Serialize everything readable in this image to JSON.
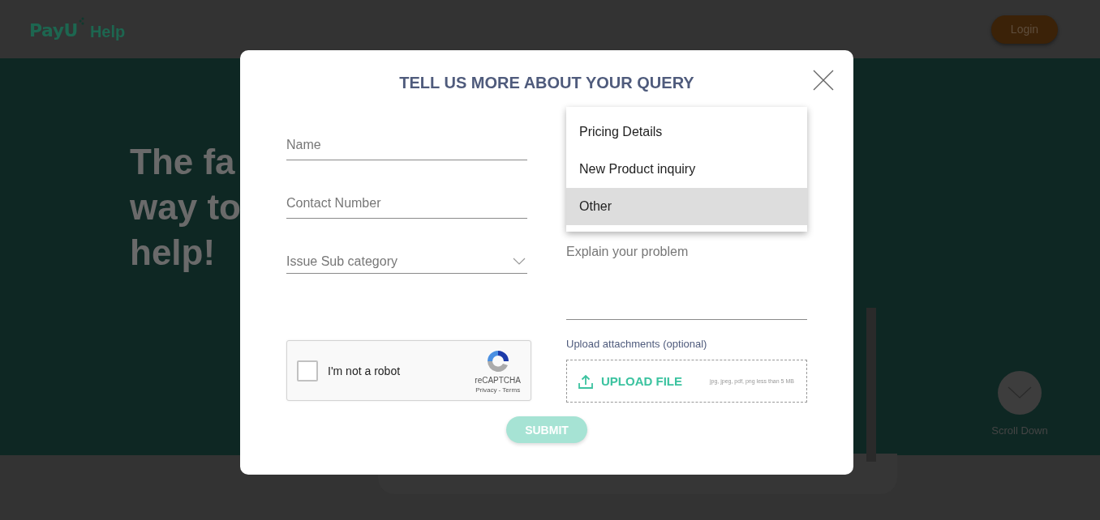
{
  "header": {
    "logo": "PayU",
    "title": "Help",
    "login": "Login"
  },
  "hero": {
    "lines": [
      "The fa",
      "way to",
      "help!"
    ],
    "scroll_label": "Scroll Down"
  },
  "modal": {
    "title": "TELL US MORE ABOUT YOUR QUERY",
    "fields": [
      {
        "kind": "text",
        "placeholder": "Name"
      },
      {
        "kind": "text",
        "placeholder": "Contact Number"
      },
      {
        "kind": "select",
        "placeholder": "Issue Sub category"
      }
    ],
    "dropdown": {
      "options": [
        {
          "label": "Pricing Details",
          "selected": false
        },
        {
          "label": "New Product inquiry",
          "selected": false
        },
        {
          "label": "Other",
          "selected": true
        }
      ]
    },
    "problem": {
      "placeholder": "Explain your problem"
    },
    "captcha": {
      "label": "I'm not a robot",
      "checked": false,
      "brand": "reCAPTCHA",
      "links": "Privacy - Terms"
    },
    "upload": {
      "label": "Upload attachments (optional)",
      "button": "UPLOAD FILE",
      "hint": "jpg, jpeg, pdf, png less than 5 MB"
    },
    "submit": {
      "label": "SUBMIT",
      "disabled": true
    }
  }
}
